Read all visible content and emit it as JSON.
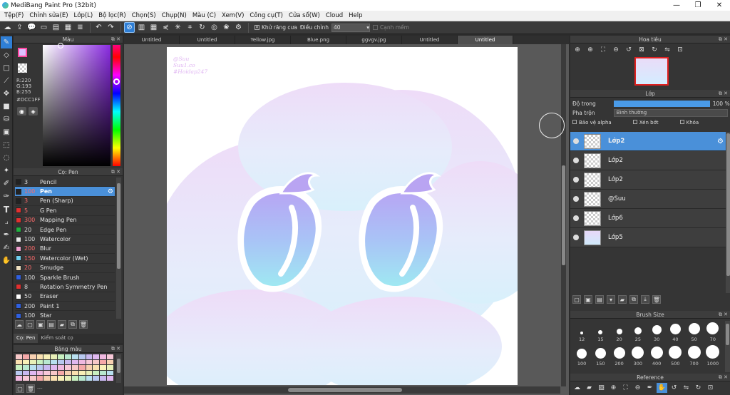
{
  "window": {
    "title": "MediBang Paint Pro (32bit)",
    "minimize": "—",
    "maximize": "❐",
    "close": "✕"
  },
  "menu": [
    "Tệp(F)",
    "Chỉnh sửa(E)",
    "Lớp(L)",
    "Bộ lọc(R)",
    "Chọn(S)",
    "Chụp(N)",
    "Màu (C)",
    "Xem(V)",
    "Công cụ(T)",
    "Cửa sổ(W)",
    "Cloud",
    "Help"
  ],
  "toolbar": {
    "antialias_label": "Khử răng cưa",
    "adjust_label": "Điều chỉnh",
    "adjust_value": "40",
    "soft_label": "Cạnh mềm"
  },
  "color_panel": {
    "title": "Màu",
    "r": "R:220",
    "g": "G:193",
    "b": "B:255",
    "hex": "#DCC1FF",
    "main_color": "#DCC1FF"
  },
  "brush_panel": {
    "title": "Cọ: Pen",
    "brushes": [
      {
        "size": "3",
        "name": "Pencil",
        "color": "#222222"
      },
      {
        "size": "100",
        "name": "Pen",
        "color": "#222222"
      },
      {
        "size": "3",
        "name": "Pen (Sharp)",
        "color": "#222222"
      },
      {
        "size": "5",
        "name": "G Pen",
        "color": "#e03030"
      },
      {
        "size": "300",
        "name": "Mapping Pen",
        "color": "#e03030"
      },
      {
        "size": "20",
        "name": "Edge Pen",
        "color": "#20b040"
      },
      {
        "size": "100",
        "name": "Watercolor",
        "color": "#e8e8e8"
      },
      {
        "size": "200",
        "name": "Blur",
        "color": "#f0a0d0"
      },
      {
        "size": "150",
        "name": "Watercolor (Wet)",
        "color": "#70d0f0"
      },
      {
        "size": "20",
        "name": "Smudge",
        "color": "#f0e0c0"
      },
      {
        "size": "100",
        "name": "Sparkle Brush",
        "color": "#3060e0"
      },
      {
        "size": "8",
        "name": "Rotation Symmetry Pen",
        "color": "#e03030"
      },
      {
        "size": "50",
        "name": "Eraser",
        "color": "#ffffff"
      },
      {
        "size": "200",
        "name": "Paint 1",
        "color": "#3060e0"
      },
      {
        "size": "100",
        "name": "Star",
        "color": "#3060e0"
      }
    ]
  },
  "bottom_tabs": [
    "Cọ: Pen",
    "Kiểm soát cọ"
  ],
  "palette_panel": {
    "title": "Bảng màu",
    "extra": "---"
  },
  "doc_tabs": [
    "Untitled",
    "Untitled",
    "Yellow.jpg",
    "Blue.png",
    "ggvgv.jpg",
    "Untitled",
    "Untitled"
  ],
  "canvas": {
    "watermark_1": "@Suu",
    "watermark_2": "Suu1.co",
    "watermark_3": "#Hoidap247"
  },
  "navigator": {
    "title": "Hoa tiêu"
  },
  "layer_panel": {
    "title": "Lớp",
    "opacity_label": "Độ trong",
    "opacity_value": "100 %",
    "opacity": 1.0,
    "blend_label": "Pha trộn",
    "blend_value": "Bình thường",
    "protect_alpha": "Bảo vệ alpha",
    "clipping": "Xén bớt",
    "lock": "Khóa",
    "layers": [
      "Lớp2",
      "Lớp2",
      "Lớp2",
      "@Suu",
      "Lớp6",
      "Lớp5"
    ]
  },
  "brush_size": {
    "title": "Brush Size",
    "sizes": [
      "12",
      "15",
      "20",
      "25",
      "30",
      "40",
      "50",
      "70",
      "100",
      "150",
      "200",
      "300",
      "400",
      "500",
      "700",
      "1000"
    ]
  },
  "reference": {
    "title": "Reference"
  }
}
